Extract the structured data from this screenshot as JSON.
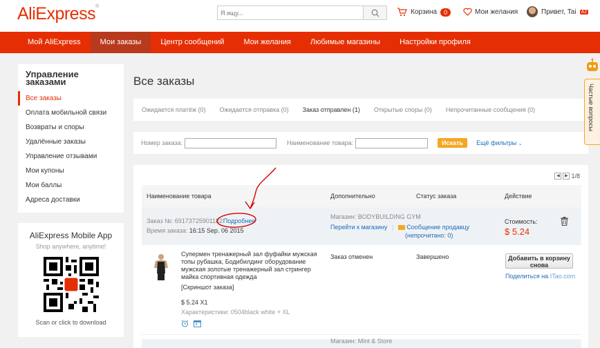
{
  "header": {
    "logo": "AliExpress",
    "logo_tm": "®",
    "search_placeholder": "Я ищу...",
    "cart_label": "Корзина",
    "cart_count": "0",
    "wishlist_label": "Мои желания",
    "greeting": "Привет, Tai",
    "user_badge": "A2"
  },
  "nav": {
    "items": [
      "Мой AliExpress",
      "Мои заказы",
      "Центр сообщений",
      "Мои желания",
      "Любимые магазины",
      "Настройки профиля"
    ],
    "active": "Мои заказы"
  },
  "sidebar": {
    "title": "Управление заказами",
    "items": [
      "Все заказы",
      "Оплата мобильной связи",
      "Возвраты и споры",
      "Удалённые заказы",
      "Управление отзывами",
      "Мои купоны",
      "Мои баллы",
      "Адреса доставки"
    ],
    "active": "Все заказы"
  },
  "app": {
    "title": "AliExpress Mobile App",
    "subtitle": "Shop anywhere, anytime!",
    "download": "Scan or click to download"
  },
  "main": {
    "title": "Все заказы",
    "tabs": [
      "Ожидается платёж (0)",
      "Ожидается отправка (0)",
      "Заказ отправлен (1)",
      "Открытые споры (0)",
      "Непрочитанные сообщения (0)"
    ],
    "active_tab": "Заказ отправлен (1)",
    "filter": {
      "order_label": "Номер заказа:",
      "product_label": "Наименование товара:",
      "search_button": "Искать",
      "more_filters": "Ещё фильтры"
    },
    "pager": "1/8",
    "columns": [
      "Наименование товара",
      "Дополнительно",
      "Статус заказа",
      "Действие"
    ],
    "order": {
      "number_label": "Заказ №:",
      "number": "69173725901182",
      "details_link": "Подробнее",
      "time_label": "Время заказа:",
      "time": "16:15 Sep. 06 2015",
      "store_label": "Магазин:",
      "store": "BODYBUILDING GYM",
      "go_to_store": "Перейти к магазину",
      "message_seller": "Сообщение продавцу",
      "unread": "(непрочитано: 0)",
      "cost_label": "Стоимость:",
      "cost": "$ 5.24"
    },
    "item": {
      "title": "Супермен тренажерный зал фуфайки мужская топы рубашка, Бодибилдинг оборудование мужская золотые тренажерный зал стрингер майка спортивная одежда",
      "snapshot": "[Скриншот заказа]",
      "price": "$ 5.24 X1",
      "specs": "Характеристики: 0504black white + XL",
      "extra_status": "Заказ отменен",
      "order_status": "Завершено",
      "add_to_cart": "Добавить в корзину снова",
      "share_prefix": "Поделиться на",
      "share_site": "ITao.com"
    },
    "next_store_partial": "Магазин: Mint & Store"
  },
  "helper": {
    "label": "Частые вопросы"
  },
  "colors": {
    "brand": "#e62e04",
    "nav_active": "#b83a1c",
    "link": "#1e6bb8",
    "search_button": "#f5a623"
  }
}
